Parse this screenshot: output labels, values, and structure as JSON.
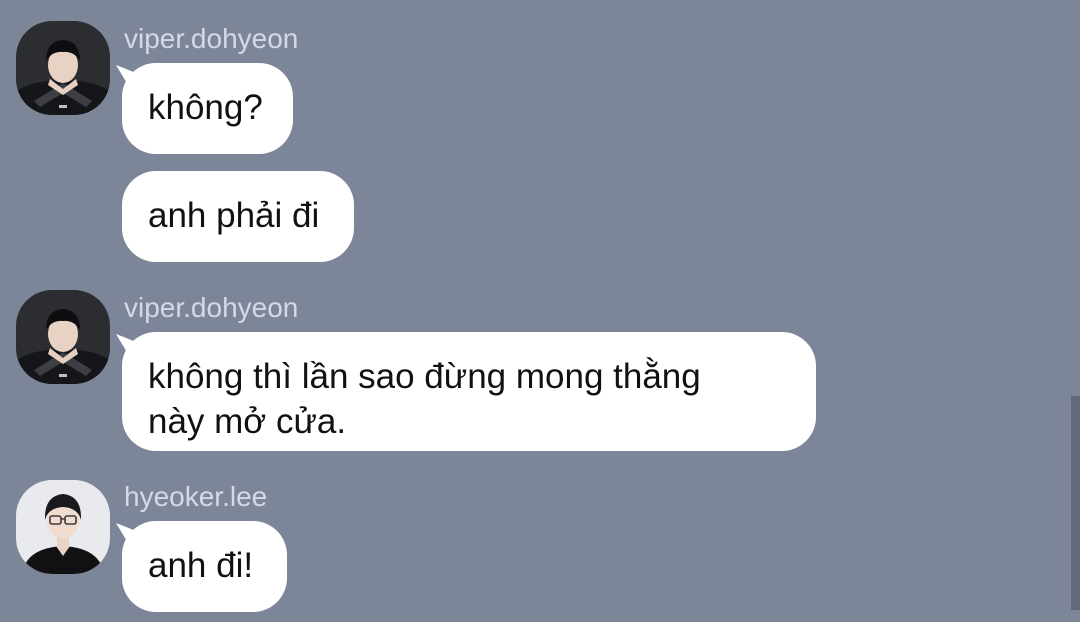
{
  "messages": [
    {
      "sender": "viper.dohyeon",
      "avatar_icon": "profile-photo-viper-icon",
      "bubbles": [
        "không?",
        "anh phải đi"
      ]
    },
    {
      "sender": "viper.dohyeon",
      "avatar_icon": "profile-photo-viper-icon",
      "bubbles": [
        "không thì lần sao đừng mong thằng",
        "này mở cửa."
      ]
    },
    {
      "sender": "hyeoker.lee",
      "avatar_icon": "profile-photo-hyeoker-icon",
      "bubbles": [
        "anh đi!"
      ]
    }
  ],
  "colors": {
    "background": "#7d8699",
    "bubble": "#ffffff",
    "sender_name": "#d5d9e2",
    "message_text": "#111111",
    "scrollbar": "#626a7a"
  }
}
